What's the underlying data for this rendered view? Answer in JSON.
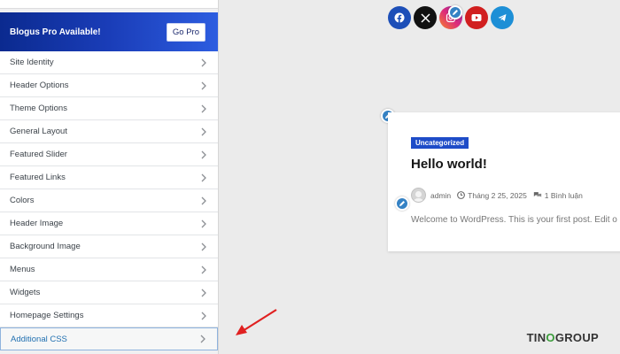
{
  "sidebar": {
    "promo": {
      "title": "Blogus Pro Available!",
      "button": "Go Pro"
    },
    "items": [
      {
        "label": "Site Identity"
      },
      {
        "label": "Header Options"
      },
      {
        "label": "Theme Options"
      },
      {
        "label": "General Layout"
      },
      {
        "label": "Featured Slider"
      },
      {
        "label": "Featured Links"
      },
      {
        "label": "Colors"
      },
      {
        "label": "Header Image"
      },
      {
        "label": "Background Image"
      },
      {
        "label": "Menus"
      },
      {
        "label": "Widgets"
      },
      {
        "label": "Homepage Settings"
      },
      {
        "label": "Additional CSS"
      }
    ]
  },
  "preview": {
    "social_icons": [
      "facebook-icon",
      "x-icon",
      "instagram-icon",
      "youtube-icon",
      "telegram-icon"
    ],
    "post": {
      "category": "Uncategorized",
      "title": "Hello world!",
      "author": "admin",
      "date": "Tháng 2 25, 2025",
      "comments": "1 Bình luận",
      "excerpt": "Welcome to WordPress. This is your first post. Edit o"
    }
  },
  "watermark": {
    "part1": "TIN",
    "part2": "O",
    "part3": "GROUP"
  },
  "colors": {
    "promo": "#1a3db8",
    "badge": "#1e4cc8",
    "facebook": "#1d4fb8",
    "x": "#111111",
    "youtube": "#d11f1f",
    "telegram": "#1d8fd6",
    "arrow": "#e02020"
  }
}
